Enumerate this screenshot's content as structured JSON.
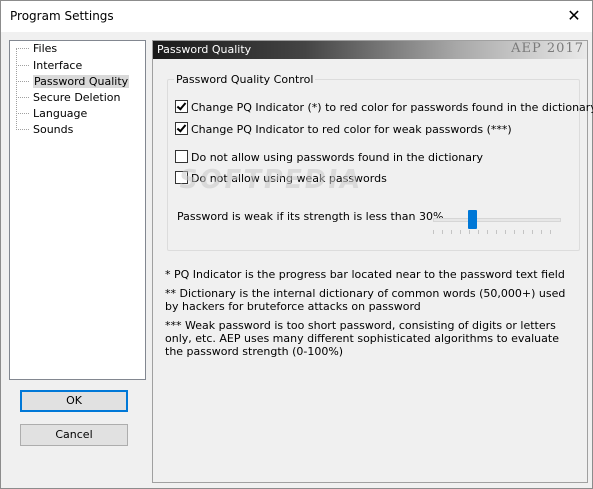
{
  "window": {
    "title": "Program Settings",
    "close_glyph": "✕"
  },
  "sidebar": {
    "items": [
      {
        "label": "Files"
      },
      {
        "label": "Interface"
      },
      {
        "label": "Password Quality",
        "selected": true
      },
      {
        "label": "Secure Deletion"
      },
      {
        "label": "Language"
      },
      {
        "label": "Sounds"
      }
    ]
  },
  "buttons": {
    "ok": "OK",
    "cancel": "Cancel"
  },
  "panel": {
    "title": "Password Quality",
    "brand": "AEP 2017",
    "group_title": "Password Quality Control",
    "options": [
      {
        "label": "Change PQ Indicator (*) to red color for passwords found in the dictionary (**)",
        "checked": true
      },
      {
        "label": "Change PQ Indicator to red color for weak passwords (***)",
        "checked": true
      },
      {
        "label": "Do not allow using passwords found in the dictionary",
        "checked": false
      },
      {
        "label": "Do not allow using weak passwords",
        "checked": false
      }
    ],
    "slider": {
      "label": "Password is weak if its strength is less than 30%",
      "value_percent": 30
    },
    "notes": [
      "* PQ Indicator is the progress bar located near to the password text field",
      "** Dictionary is the internal dictionary of common words (50,000+) used by hackers for bruteforce attacks on password",
      "*** Weak password is too short password, consisting of digits or letters only, etc. AEP uses many different sophisticated algorithms to evaluate the password strength (0-100%)"
    ]
  },
  "watermark": "SOFTPEDIA",
  "colors": {
    "accent": "#0078d7",
    "selection": "#d9d9d9"
  }
}
